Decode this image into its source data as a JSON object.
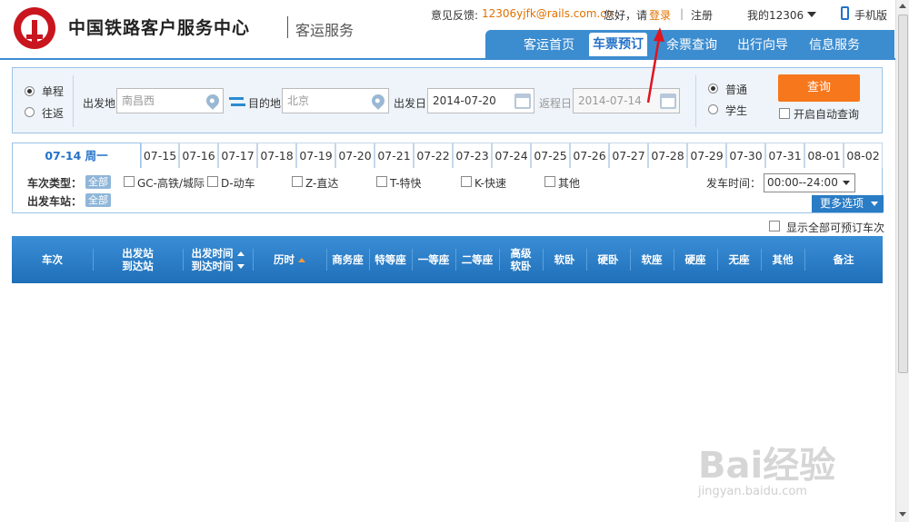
{
  "header": {
    "site_title": "中国铁路客户服务中心",
    "site_sub": "客运服务",
    "feedback_label": "意见反馈:",
    "feedback_email": "12306yjfk@rails.com.cn",
    "greeting": "您好，请",
    "login": "登录",
    "separator": "|",
    "register": "注册",
    "my_account": "我的12306",
    "mobile": "手机版"
  },
  "nav": {
    "items": [
      {
        "label": "客运首页"
      },
      {
        "label": "车票预订"
      },
      {
        "label": "余票查询"
      },
      {
        "label": "出行向导"
      },
      {
        "label": "信息服务"
      }
    ]
  },
  "search": {
    "trip_one_way": "单程",
    "trip_round": "往返",
    "from_label": "出发地",
    "from_value": "南昌西",
    "to_label": "目的地",
    "to_value": "北京",
    "depart_label": "出发日",
    "depart_value": "2014-07-20",
    "return_label": "返程日",
    "return_value": "2014-07-14",
    "ticket_normal": "普通",
    "ticket_student": "学生",
    "query_button": "查询",
    "auto_query": "开启自动查询"
  },
  "date_tabs": [
    "07-14 周一",
    "07-15",
    "07-16",
    "07-17",
    "07-18",
    "07-19",
    "07-20",
    "07-21",
    "07-22",
    "07-23",
    "07-24",
    "07-25",
    "07-26",
    "07-27",
    "07-28",
    "07-29",
    "07-30",
    "07-31",
    "08-01",
    "08-02"
  ],
  "filter": {
    "train_type_label": "车次类型：",
    "all": "全部",
    "types": [
      "GC-高铁/城际",
      "D-动车",
      "Z-直达",
      "T-特快",
      "K-快速",
      "其他"
    ],
    "station_label": "出发车站：",
    "station_all": "全部",
    "time_label": "发车时间：",
    "time_value": "00:00--24:00",
    "more_options": "更多选项"
  },
  "show_all_label": "显示全部可预订车次",
  "table_header": {
    "train_no": "车次",
    "from_station": "出发站",
    "to_station": "到达站",
    "depart_time": "出发时间",
    "arrive_time": "到达时间",
    "duration": "历时",
    "business": "商务座",
    "special": "特等座",
    "first": "一等座",
    "second": "二等座",
    "premium_sleeper_1": "高级",
    "premium_sleeper_2": "软卧",
    "soft_sleeper": "软卧",
    "hard_sleeper": "硬卧",
    "soft_seat": "软座",
    "hard_seat": "硬座",
    "no_seat": "无座",
    "other": "其他",
    "remark": "备注"
  },
  "watermark": {
    "brand": "Bai经验",
    "url": "jingyan.baidu.com"
  },
  "colors": {
    "nav_blue": "#3c8cd0",
    "accent_orange": "#f7771c",
    "link_orange": "#e17100",
    "logo_red": "#c9151e",
    "annotation_red": "#e0141e"
  }
}
